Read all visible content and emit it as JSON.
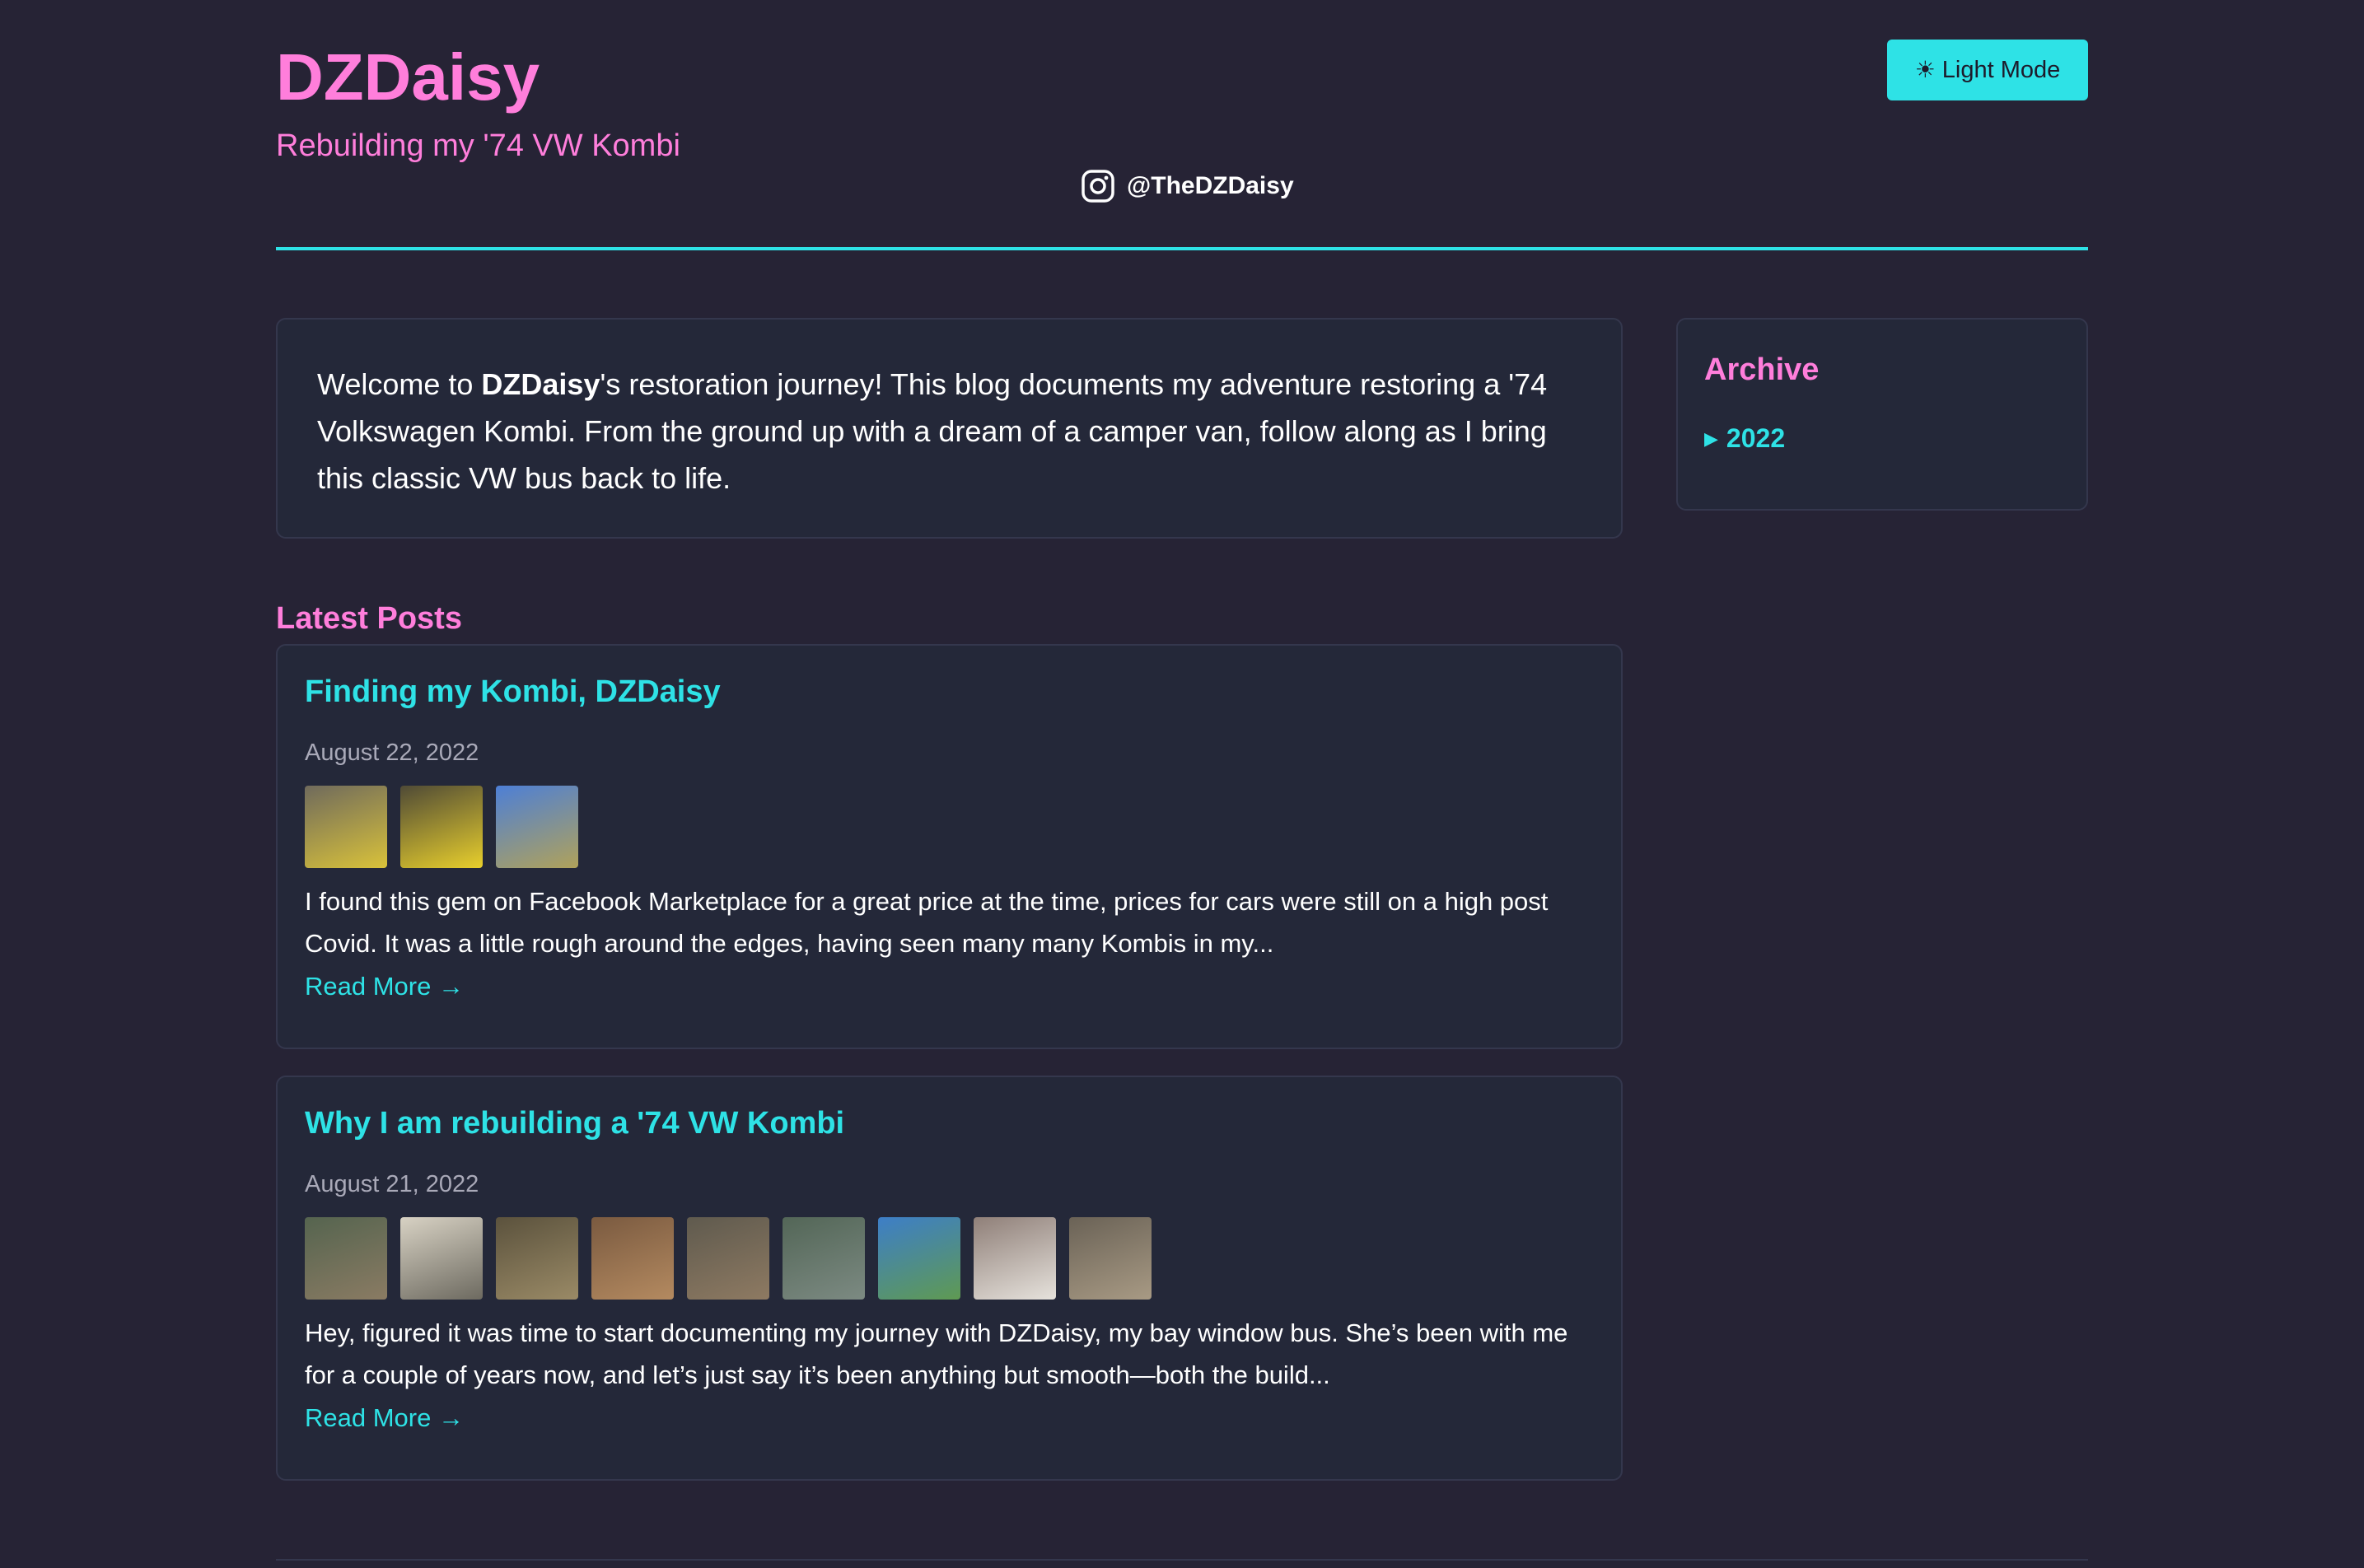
{
  "header": {
    "title": "DZDaisy",
    "subtitle": "Rebuilding my '74 VW Kombi",
    "theme_button": {
      "icon": "sun-icon",
      "label": "Light Mode"
    },
    "instagram": {
      "icon": "instagram-icon",
      "handle": "@TheDZDaisy"
    }
  },
  "intro": {
    "before": "Welcome to ",
    "bold": "DZDaisy",
    "after": "'s restoration journey! This blog documents my adventure restoring a '74 Volkswagen Kombi. From the ground up with a dream of a camper van, follow along as I bring this classic VW bus back to life."
  },
  "archive": {
    "title": "Archive",
    "years": [
      {
        "icon": "triangle-right-icon",
        "label": "2022"
      }
    ]
  },
  "latest": {
    "heading": "Latest Posts",
    "posts": [
      {
        "title": "Finding my Kombi, DZDaisy",
        "date": "August 22, 2022",
        "excerpt": "I found this gem on Facebook Marketplace for a great price at the time, prices for cars were still on a high post Covid. It was a little rough around the edges, having seen many many Kombis in my...",
        "read_more": "Read More →",
        "thumbnails": [
          {
            "name": "yellow-kombi-garage-photo",
            "colors": [
              "#6f6a5c",
              "#d9c23a"
            ]
          },
          {
            "name": "yellow-kombi-rear-photo",
            "colors": [
              "#4f4a36",
              "#e8cf2c"
            ]
          },
          {
            "name": "kombi-on-trailer-photo",
            "colors": [
              "#4d7fd6",
              "#b0a25a"
            ]
          }
        ]
      },
      {
        "title": "Why I am rebuilding a '74 VW Kombi",
        "date": "August 21, 2022",
        "excerpt": "Hey, figured it was time to start documenting my journey with DZDaisy, my bay window bus. She’s been with me for a couple of years now, and let’s just say it’s been anything but smooth—both the build...",
        "read_more": "Read More →",
        "thumbnails": [
          {
            "name": "kombi-in-yard-photo",
            "colors": [
              "#55644f",
              "#8a7b63"
            ]
          },
          {
            "name": "vw-club-sticker-photo",
            "colors": [
              "#d8d2c4",
              "#6d6a60"
            ]
          },
          {
            "name": "kombi-bush-photo",
            "colors": [
              "#5b523d",
              "#9a8a66"
            ]
          },
          {
            "name": "tree-trunk-photo",
            "colors": [
              "#7a5a40",
              "#b48a60"
            ]
          },
          {
            "name": "rusty-kombi-photo",
            "colors": [
              "#5f5a4e",
              "#8e7a62"
            ]
          },
          {
            "name": "green-kombi-photo",
            "colors": [
              "#536657",
              "#7c8a82"
            ]
          },
          {
            "name": "blue-car-road-photo",
            "colors": [
              "#3d7ec8",
              "#5f9a52"
            ]
          },
          {
            "name": "camper-interior-bed-photo",
            "colors": [
              "#8f7f78",
              "#e6e2dc"
            ]
          },
          {
            "name": "camper-interior-photo",
            "colors": [
              "#6a6256",
              "#a89a84"
            ]
          }
        ]
      }
    ]
  },
  "colors": {
    "background": "#262335",
    "card": "#242839",
    "pink": "#ff7edb",
    "cyan": "#2ee2e6"
  }
}
